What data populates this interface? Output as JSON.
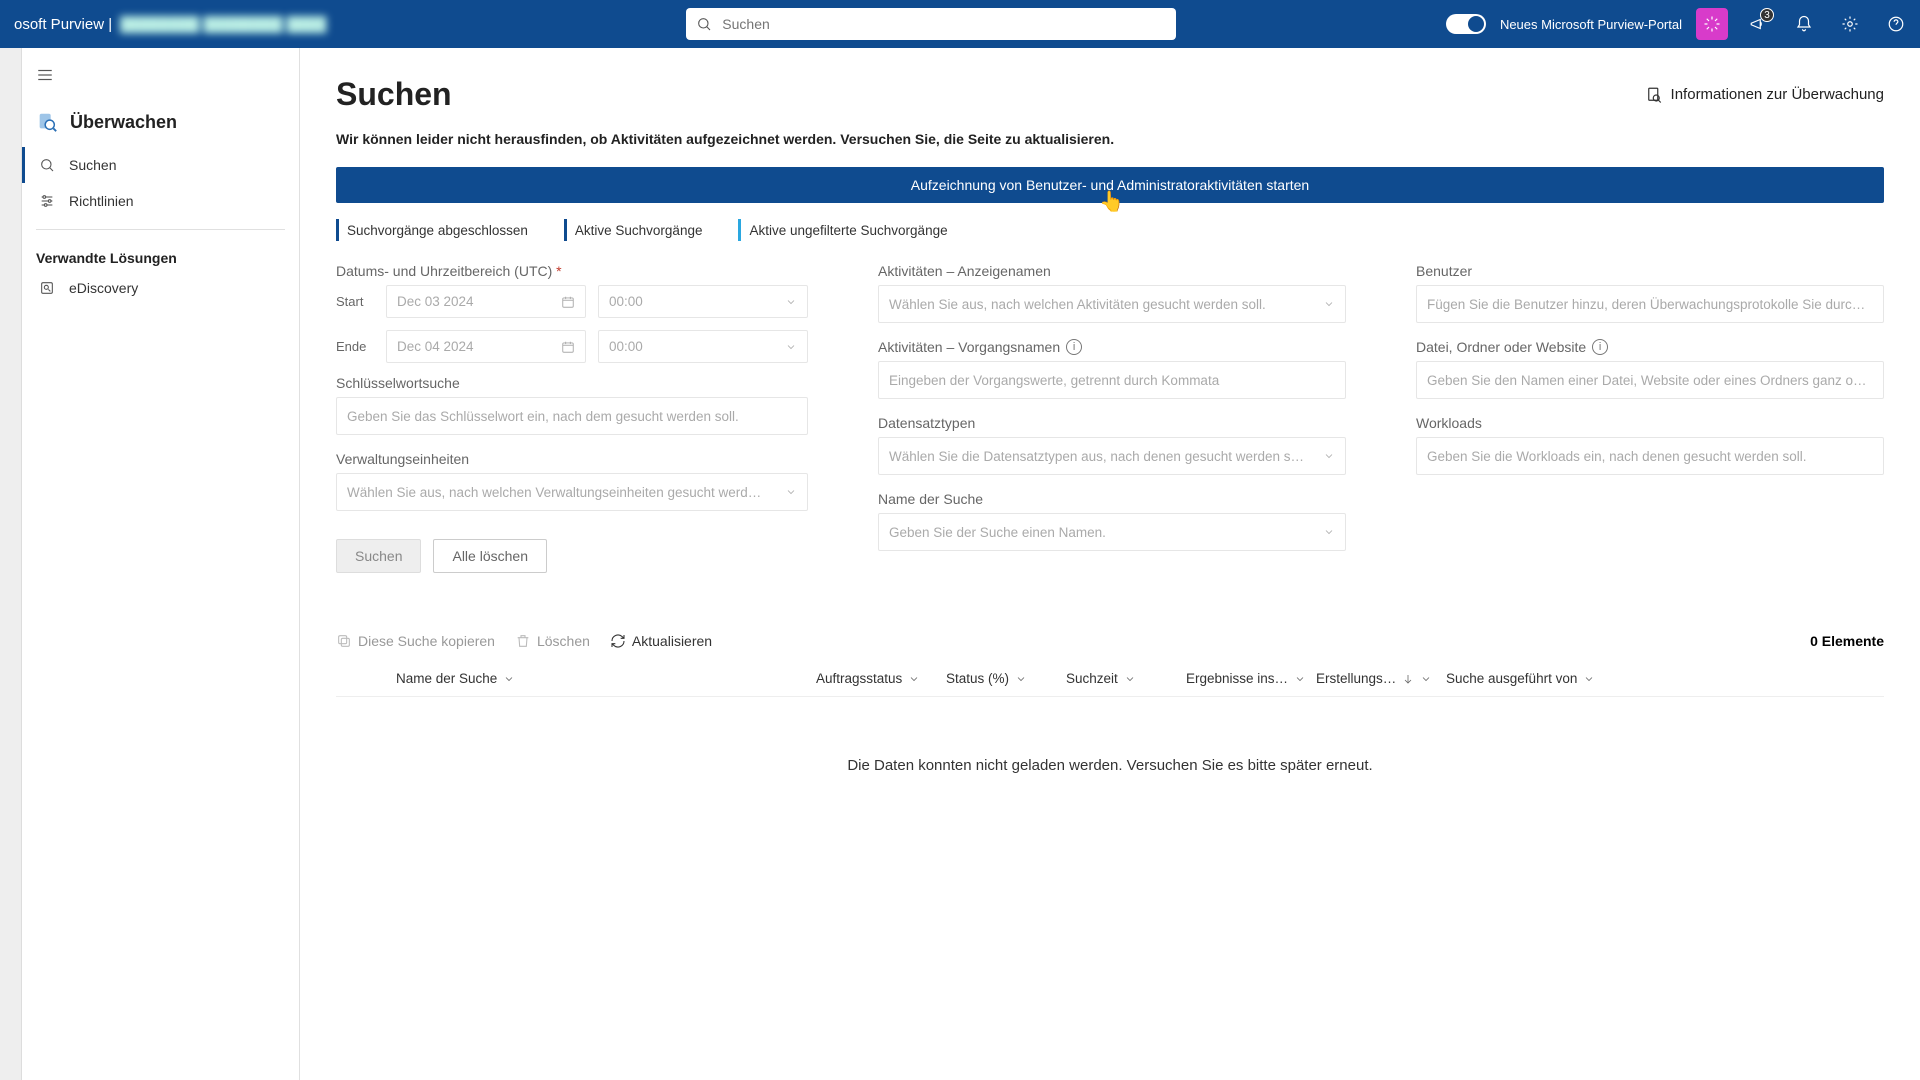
{
  "header": {
    "brand_prefix": "osoft Purview |",
    "brand_blur": "████████ ████████ ████",
    "search_placeholder": "Suchen",
    "portal_toggle_label": "Neues Microsoft Purview-Portal",
    "badge_count": "3"
  },
  "sidebar": {
    "title": "Überwachen",
    "items": [
      {
        "label": "Suchen",
        "active": true
      },
      {
        "label": "Richtlinien",
        "active": false
      }
    ],
    "section_label": "Verwandte Lösungen",
    "related": [
      {
        "label": "eDiscovery"
      }
    ]
  },
  "page": {
    "title": "Suchen",
    "info_link": "Informationen zur Überwachung",
    "warning": "Wir können leider nicht herausfinden, ob Aktivitäten aufgezeichnet werden. Versuchen Sie, die Seite zu aktualisieren.",
    "start_button": "Aufzeichnung von Benutzer- und Administratoraktivitäten starten",
    "legend": [
      {
        "label": "Suchvorgänge abgeschlossen",
        "color": "#0f4b8f"
      },
      {
        "label": "Aktive Suchvorgänge",
        "color": "#0f4b8f"
      },
      {
        "label": "Aktive ungefilterte Suchvorgänge",
        "color": "#2aa7e0"
      }
    ]
  },
  "form": {
    "datetime_label": "Datums- und Uhrzeitbereich (UTC)",
    "start_label": "Start",
    "start_date": "Dec 03 2024",
    "start_time": "00:00",
    "end_label": "Ende",
    "end_date": "Dec 04 2024",
    "end_time": "00:00",
    "keyword_label": "Schlüsselwortsuche",
    "keyword_placeholder": "Geben Sie das Schlüsselwort ein, nach dem gesucht werden soll.",
    "admin_units_label": "Verwaltungseinheiten",
    "admin_units_placeholder": "Wählen Sie aus, nach welchen Verwaltungseinheiten gesucht werd…",
    "activities_display_label": "Aktivitäten – Anzeigenamen",
    "activities_display_placeholder": "Wählen Sie aus, nach welchen Aktivitäten gesucht werden soll.",
    "activities_op_label": "Aktivitäten – Vorgangsnamen",
    "activities_op_placeholder": "Eingeben der Vorgangswerte, getrennt durch Kommata",
    "record_types_label": "Datensatztypen",
    "record_types_placeholder": "Wählen Sie die Datensatztypen aus, nach denen gesucht werden s…",
    "search_name_label": "Name der Suche",
    "search_name_placeholder": "Geben Sie der Suche einen Namen.",
    "users_label": "Benutzer",
    "users_placeholder": "Fügen Sie die Benutzer hinzu, deren Überwachungsprotokolle Sie durc…",
    "file_label": "Datei, Ordner oder Website",
    "file_placeholder": "Geben Sie den Namen einer Datei, Website oder eines Ordners ganz o…",
    "workloads_label": "Workloads",
    "workloads_placeholder": "Geben Sie die Workloads ein, nach denen gesucht werden soll.",
    "search_btn": "Suchen",
    "clear_btn": "Alle löschen"
  },
  "table": {
    "action_copy": "Diese Suche kopieren",
    "action_delete": "Löschen",
    "action_refresh": "Aktualisieren",
    "count_label": "0 Elemente",
    "columns": {
      "name": "Name der Suche",
      "status": "Auftragsstatus",
      "pct": "Status (%)",
      "time": "Suchzeit",
      "results": "Ergebnisse ins…",
      "created": "Erstellungs…",
      "runby": "Suche ausgeführt von"
    },
    "error_msg": "Die Daten konnten nicht geladen werden. Versuchen Sie es bitte später erneut."
  }
}
